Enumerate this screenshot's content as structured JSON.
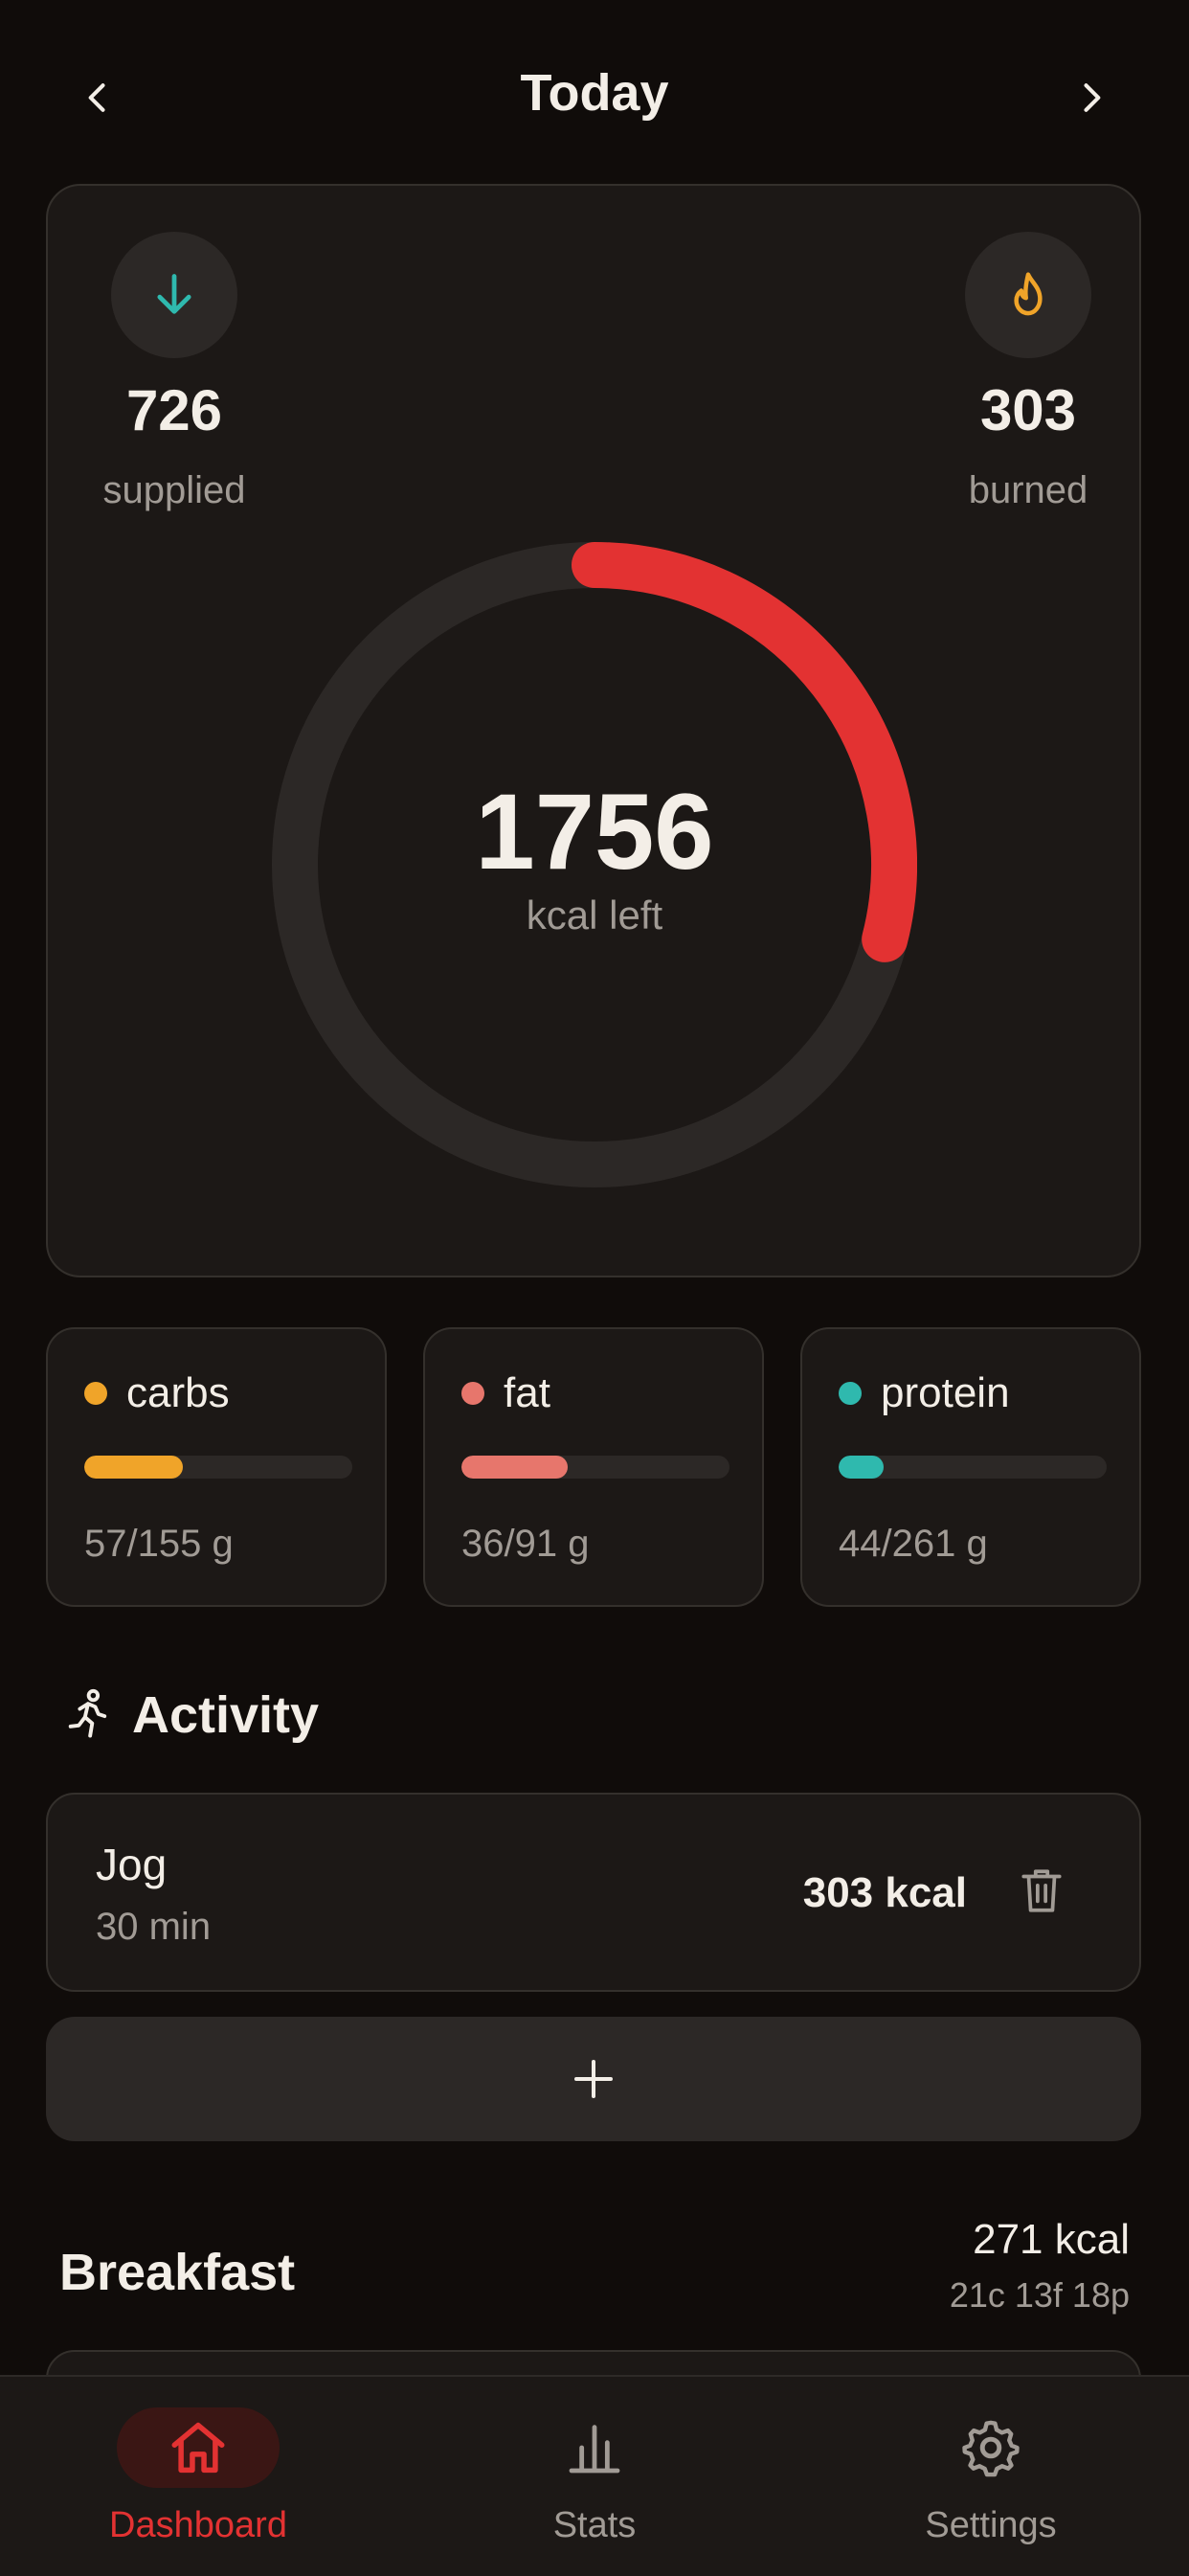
{
  "header": {
    "title": "Today"
  },
  "summary": {
    "supplied": {
      "value": "726",
      "label": "supplied"
    },
    "burned": {
      "value": "303",
      "label": "burned"
    },
    "remaining": {
      "value": "1756",
      "label": "kcal left"
    },
    "ring_progress": 0.29,
    "colors": {
      "accent": "#e33232",
      "supplied_icon": "#2fb9ae",
      "burned_icon": "#f0a429"
    }
  },
  "macros": [
    {
      "name": "carbs",
      "value": "57/155 g",
      "fraction": 0.368,
      "color": "#f0a429"
    },
    {
      "name": "fat",
      "value": "36/91 g",
      "fraction": 0.396,
      "color": "#e7766c"
    },
    {
      "name": "protein",
      "value": "44/261 g",
      "fraction": 0.169,
      "color": "#2fb9ae"
    }
  ],
  "activity": {
    "title": "Activity",
    "items": [
      {
        "name": "Jog",
        "duration": "30 min",
        "kcal": "303 kcal"
      }
    ],
    "add_label": "+"
  },
  "meals": [
    {
      "title": "Breakfast",
      "kcal": "271 kcal",
      "macros": "21c 13f 18p"
    }
  ],
  "tabbar": {
    "tabs": [
      {
        "label": "Dashboard",
        "icon": "home-icon",
        "active": true
      },
      {
        "label": "Stats",
        "icon": "bar-chart-icon",
        "active": false
      },
      {
        "label": "Settings",
        "icon": "gear-icon",
        "active": false
      }
    ],
    "active_color": "#e33232",
    "inactive_color": "#a19b95"
  }
}
